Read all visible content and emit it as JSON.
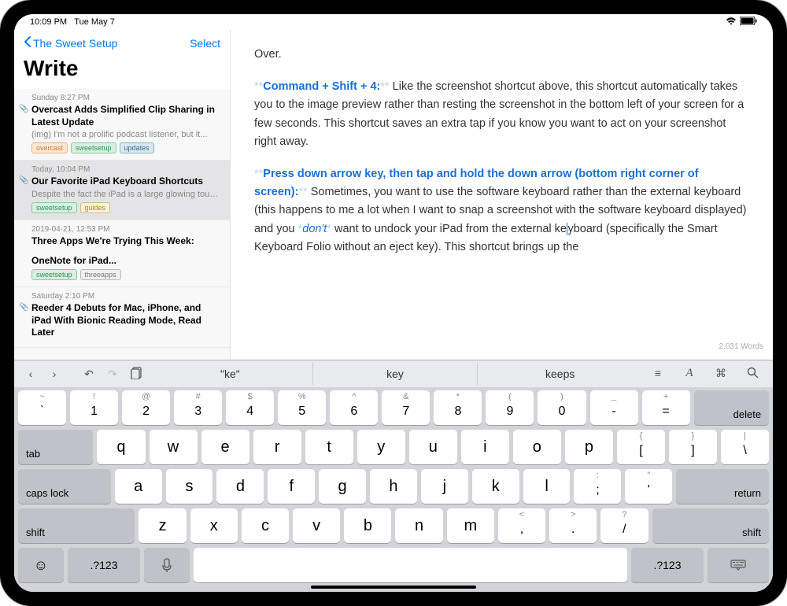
{
  "status": {
    "time": "10:09 PM",
    "date": "Tue May 7"
  },
  "sidebar": {
    "back_label": "The Sweet Setup",
    "select_label": "Select",
    "title": "Write",
    "notes": [
      {
        "date": "Sunday 8:27 PM",
        "title": "Overcast Adds Simplified Clip Sharing in Latest Update",
        "preview": "(img) I'm not a prolific podcast listener, but it...",
        "tags": [
          "overcast",
          "sweetsetup",
          "updates"
        ],
        "attach": true
      },
      {
        "date": "Today, 10:04 PM",
        "title": "Our Favorite iPad Keyboard Shortcuts",
        "preview": "Despite the fact the iPad is a large glowing touchscreen, it almost feels like it was built to...",
        "tags": [
          "sweetsetup",
          "guides"
        ],
        "attach": true,
        "selected": true
      },
      {
        "date": "2019-04-21, 12:53 PM",
        "title": "Three Apps We're Trying This Week:",
        "subtitle": "OneNote for iPad...",
        "tags": [
          "sweetsetup",
          "threeapps"
        ]
      },
      {
        "date": "Saturday 2:10 PM",
        "title": "Reeder 4 Debuts for Mac, iPhone, and iPad With Bionic Reading Mode, Read Later",
        "attach": true
      }
    ]
  },
  "editor": {
    "p0": "Over.",
    "s1_bold": "Command + Shift + 4:",
    "s1_body": " Like the screenshot shortcut above, this shortcut automatically takes you to the image preview rather than resting the screenshot in the bottom left of your screen for a few seconds. This shortcut saves an extra tap if you know you want to act on your screenshot right away.",
    "s2_bold": "Press down arrow key, then tap and hold the down arrow (bottom right corner of screen):",
    "s2_body_a": " Sometimes, you want to use the software keyboard rather than the external keyboard (this happens to me a lot when I want to snap a screenshot with the software keyboard displayed) and you ",
    "s2_italic": "don't",
    "s2_body_b": " want to undock your iPad from the external ke",
    "s2_body_c": "yboard (specifically the Smart Keyboard Folio without an eject key). This shortcut brings up the",
    "word_count": "2,031 Words"
  },
  "toolbar": {
    "suggestions": [
      "\"ke\"",
      "key",
      "keeps"
    ]
  },
  "keys": {
    "row1": [
      {
        "sub": "~",
        "main": "`"
      },
      {
        "sub": "!",
        "main": "1"
      },
      {
        "sub": "@",
        "main": "2"
      },
      {
        "sub": "#",
        "main": "3"
      },
      {
        "sub": "$",
        "main": "4"
      },
      {
        "sub": "%",
        "main": "5"
      },
      {
        "sub": "^",
        "main": "6"
      },
      {
        "sub": "&",
        "main": "7"
      },
      {
        "sub": "*",
        "main": "8"
      },
      {
        "sub": "(",
        "main": "9"
      },
      {
        "sub": ")",
        "main": "0"
      },
      {
        "sub": "_",
        "main": "-"
      },
      {
        "sub": "+",
        "main": "="
      }
    ],
    "delete": "delete",
    "tab": "tab",
    "row2": [
      {
        "m": "q"
      },
      {
        "m": "w"
      },
      {
        "m": "e"
      },
      {
        "m": "r"
      },
      {
        "m": "t"
      },
      {
        "m": "y"
      },
      {
        "m": "u"
      },
      {
        "m": "i"
      },
      {
        "m": "o"
      },
      {
        "m": "p"
      },
      {
        "sub": "{",
        "main": "["
      },
      {
        "sub": "}",
        "main": "]"
      },
      {
        "sub": "|",
        "main": "\\"
      }
    ],
    "caps": "caps lock",
    "row3": [
      {
        "m": "a"
      },
      {
        "m": "s"
      },
      {
        "m": "d"
      },
      {
        "m": "f"
      },
      {
        "m": "g"
      },
      {
        "m": "h"
      },
      {
        "m": "j"
      },
      {
        "m": "k"
      },
      {
        "m": "l"
      },
      {
        "sub": ":",
        "main": ";"
      },
      {
        "sub": "\"",
        "main": "'"
      }
    ],
    "return": "return",
    "shift": "shift",
    "row4": [
      {
        "m": "z"
      },
      {
        "m": "x"
      },
      {
        "m": "c"
      },
      {
        "m": "v"
      },
      {
        "m": "b"
      },
      {
        "m": "n"
      },
      {
        "m": "m"
      },
      {
        "sub": "<",
        "main": ","
      },
      {
        "sub": ">",
        "main": "."
      },
      {
        "sub": "?",
        "main": "/"
      }
    ],
    "numswitch": ".?123"
  }
}
